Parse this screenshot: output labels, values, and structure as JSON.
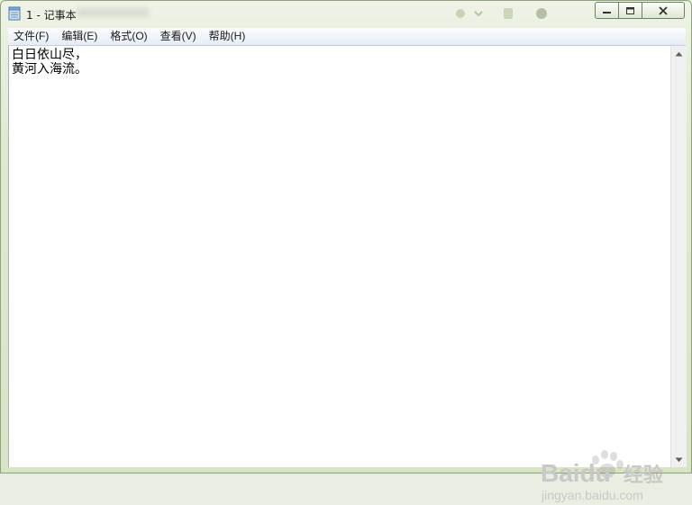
{
  "window": {
    "title": "1 - 记事本",
    "icon": "notepad-icon"
  },
  "menu": {
    "items": [
      {
        "label": "文件(F)"
      },
      {
        "label": "编辑(E)"
      },
      {
        "label": "格式(O)"
      },
      {
        "label": "查看(V)"
      },
      {
        "label": "帮助(H)"
      }
    ]
  },
  "editor": {
    "line1": "白日依山尽，",
    "line2": "黄河入海流。"
  },
  "watermark": {
    "brand": "Baidu",
    "brand_cn": "经验",
    "url": "jingyan.baidu.com"
  },
  "colors": {
    "frame": "#d8e4c6",
    "menubar": "#e6ebf5",
    "editor_bg": "#ffffff"
  }
}
